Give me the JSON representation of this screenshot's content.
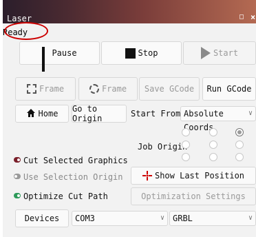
{
  "window": {
    "title": "Laser",
    "status": "Ready"
  },
  "accent_colors": {
    "title_gradient": [
      "#2b1e2b",
      "#b46a52"
    ],
    "annotation_circle": "#cc0000",
    "toggle_on_red": "#7a1f2a",
    "toggle_on_green": "#2e9a5a"
  },
  "controls": {
    "pause": "Pause",
    "stop": "Stop",
    "start": "Start",
    "frame": "Frame",
    "frame_circle": "Frame",
    "save_gcode": "Save GCode",
    "run_gcode": "Run GCode",
    "home": "Home",
    "go_to_origin": "Go to Origin"
  },
  "start_from": {
    "label": "Start From:",
    "value": "Absolute Coords"
  },
  "job_origin": {
    "label": "Job Origin",
    "selected": "top-right"
  },
  "options": {
    "cut_selected": "Cut Selected Graphics",
    "use_selection_origin": "Use Selection Origin",
    "optimize_cut_path": "Optimize Cut Path",
    "show_last_position": "Show Last Position",
    "optimization_settings": "Optimization Settings"
  },
  "devices": {
    "button": "Devices",
    "port": "COM3",
    "firmware": "GRBL"
  },
  "icons": [
    "pin-icon",
    "close-icon",
    "pause-icon",
    "stop-icon",
    "play-icon",
    "frame-rect-icon",
    "frame-circle-icon",
    "home-icon",
    "crosshair-icon",
    "chevron-down-icon"
  ]
}
